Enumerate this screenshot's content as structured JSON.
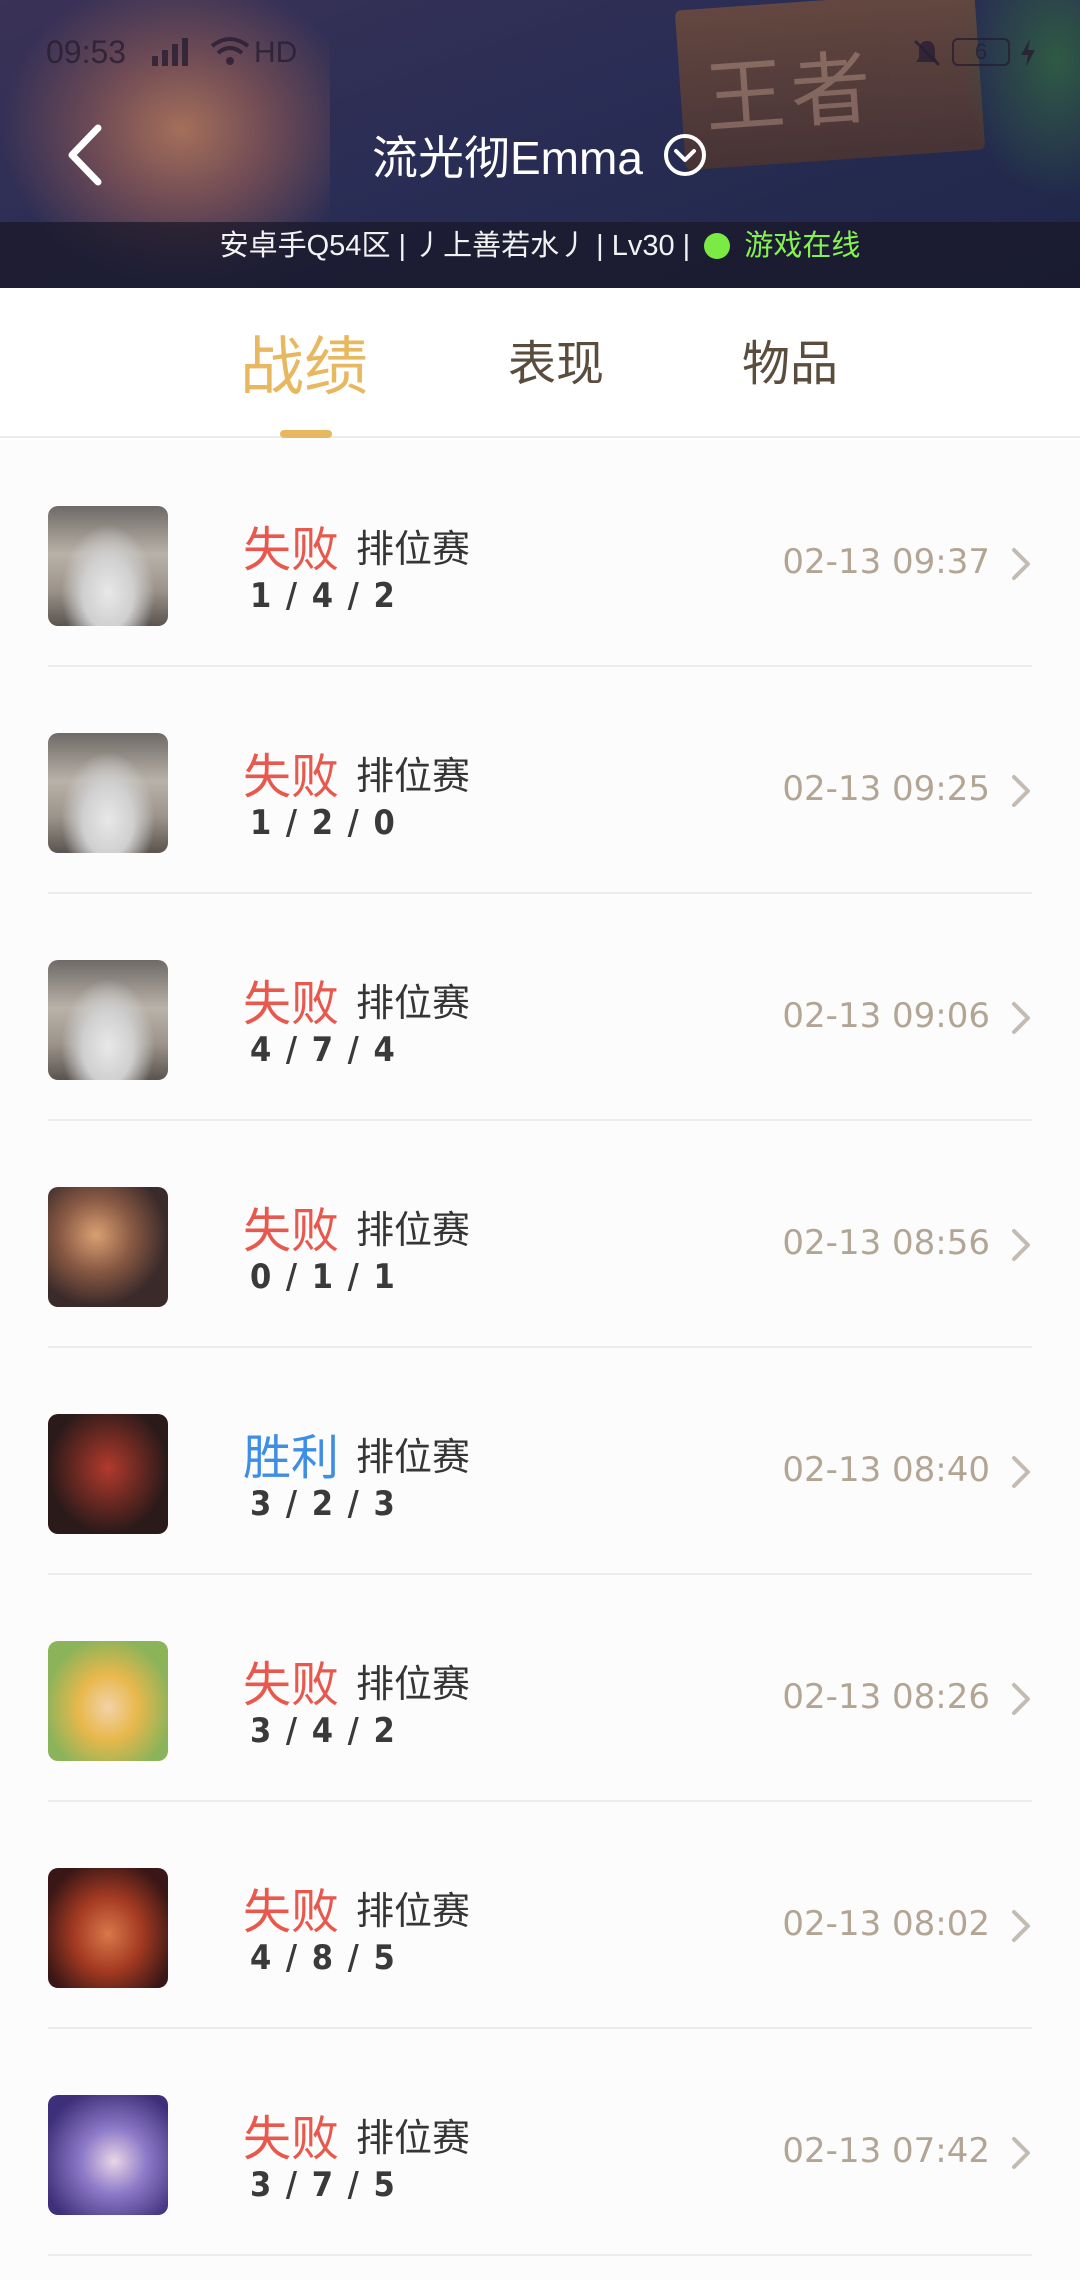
{
  "status_bar": {
    "time": "09:53",
    "network": "HD",
    "battery": "6"
  },
  "header": {
    "title": "流光彻Emma",
    "info_prefix": "安卓手Q54区 | 丿上善若水丿 | Lv30 |",
    "online_text": "游戏在线",
    "colors": {
      "online": "#86f250",
      "title": "#ffffff"
    }
  },
  "tabs": [
    {
      "label": "战绩",
      "active": true
    },
    {
      "label": "表现",
      "active": false
    },
    {
      "label": "物品",
      "active": false
    }
  ],
  "colors": {
    "accent": "#e8b860",
    "loss": "#e8584c",
    "win": "#3f8ee6",
    "time": "#b3a593"
  },
  "matches": [
    {
      "result": "失败",
      "outcome": "loss",
      "mode": "排位赛",
      "kda": "1 / 4 / 2",
      "time": "02-13 09:37",
      "hero_icon": "old-sage-avatar"
    },
    {
      "result": "失败",
      "outcome": "loss",
      "mode": "排位赛",
      "kda": "1 / 2 / 0",
      "time": "02-13 09:25",
      "hero_icon": "old-sage-avatar"
    },
    {
      "result": "失败",
      "outcome": "loss",
      "mode": "排位赛",
      "kda": "4 / 7 / 4",
      "time": "02-13 09:06",
      "hero_icon": "old-sage-avatar"
    },
    {
      "result": "失败",
      "outcome": "loss",
      "mode": "排位赛",
      "kda": "0 / 1 / 1",
      "time": "02-13 08:56",
      "hero_icon": "warrior-avatar"
    },
    {
      "result": "胜利",
      "outcome": "win",
      "mode": "排位赛",
      "kda": "3 / 2 / 3",
      "time": "02-13 08:40",
      "hero_icon": "masked-warrior-avatar"
    },
    {
      "result": "失败",
      "outcome": "loss",
      "mode": "排位赛",
      "kda": "3 / 4 / 2",
      "time": "02-13 08:26",
      "hero_icon": "girl-avatar"
    },
    {
      "result": "失败",
      "outcome": "loss",
      "mode": "排位赛",
      "kda": "4 / 8 / 5",
      "time": "02-13 08:02",
      "hero_icon": "red-warrior-avatar"
    },
    {
      "result": "失败",
      "outcome": "loss",
      "mode": "排位赛",
      "kda": "3 / 7 / 5",
      "time": "02-13 07:42",
      "hero_icon": "purple-mage-avatar"
    }
  ]
}
